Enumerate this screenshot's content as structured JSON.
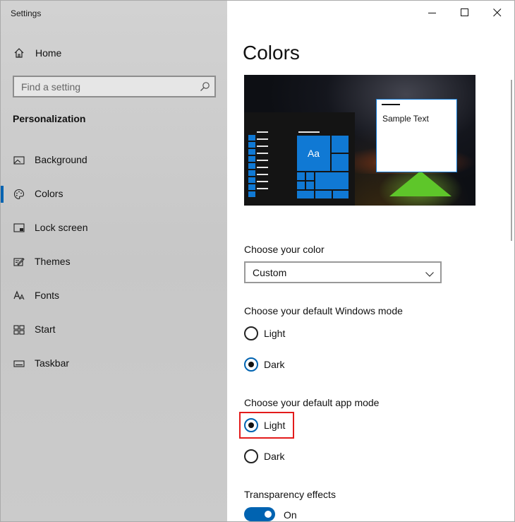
{
  "window": {
    "title": "Settings",
    "controls": {
      "minimize": "minimize-icon",
      "maximize": "maximize-icon",
      "close": "close-icon"
    }
  },
  "sidebar": {
    "home_label": "Home",
    "search": {
      "placeholder": "Find a setting",
      "icon": "search-icon"
    },
    "section_title": "Personalization",
    "items": [
      {
        "label": "Background",
        "icon": "picture-icon",
        "selected": false
      },
      {
        "label": "Colors",
        "icon": "palette-icon",
        "selected": true
      },
      {
        "label": "Lock screen",
        "icon": "lock-screen-icon",
        "selected": false
      },
      {
        "label": "Themes",
        "icon": "themes-icon",
        "selected": false
      },
      {
        "label": "Fonts",
        "icon": "fonts-icon",
        "selected": false
      },
      {
        "label": "Start",
        "icon": "start-icon",
        "selected": false
      },
      {
        "label": "Taskbar",
        "icon": "taskbar-icon",
        "selected": false
      }
    ]
  },
  "main": {
    "title": "Colors",
    "preview": {
      "tile_text": "Aa",
      "sample_text": "Sample Text"
    },
    "choose_color": {
      "label": "Choose your color",
      "value": "Custom"
    },
    "windows_mode": {
      "label": "Choose your default Windows mode",
      "options": [
        {
          "label": "Light",
          "checked": false
        },
        {
          "label": "Dark",
          "checked": true
        }
      ]
    },
    "app_mode": {
      "label": "Choose your default app mode",
      "options": [
        {
          "label": "Light",
          "checked": true
        },
        {
          "label": "Dark",
          "checked": false
        }
      ]
    },
    "transparency": {
      "label": "Transparency effects",
      "state_label": "On",
      "on": true
    }
  },
  "colors": {
    "accent": "#0063b1",
    "tile_blue": "#1079d4",
    "highlight_red": "#e31b1b"
  }
}
